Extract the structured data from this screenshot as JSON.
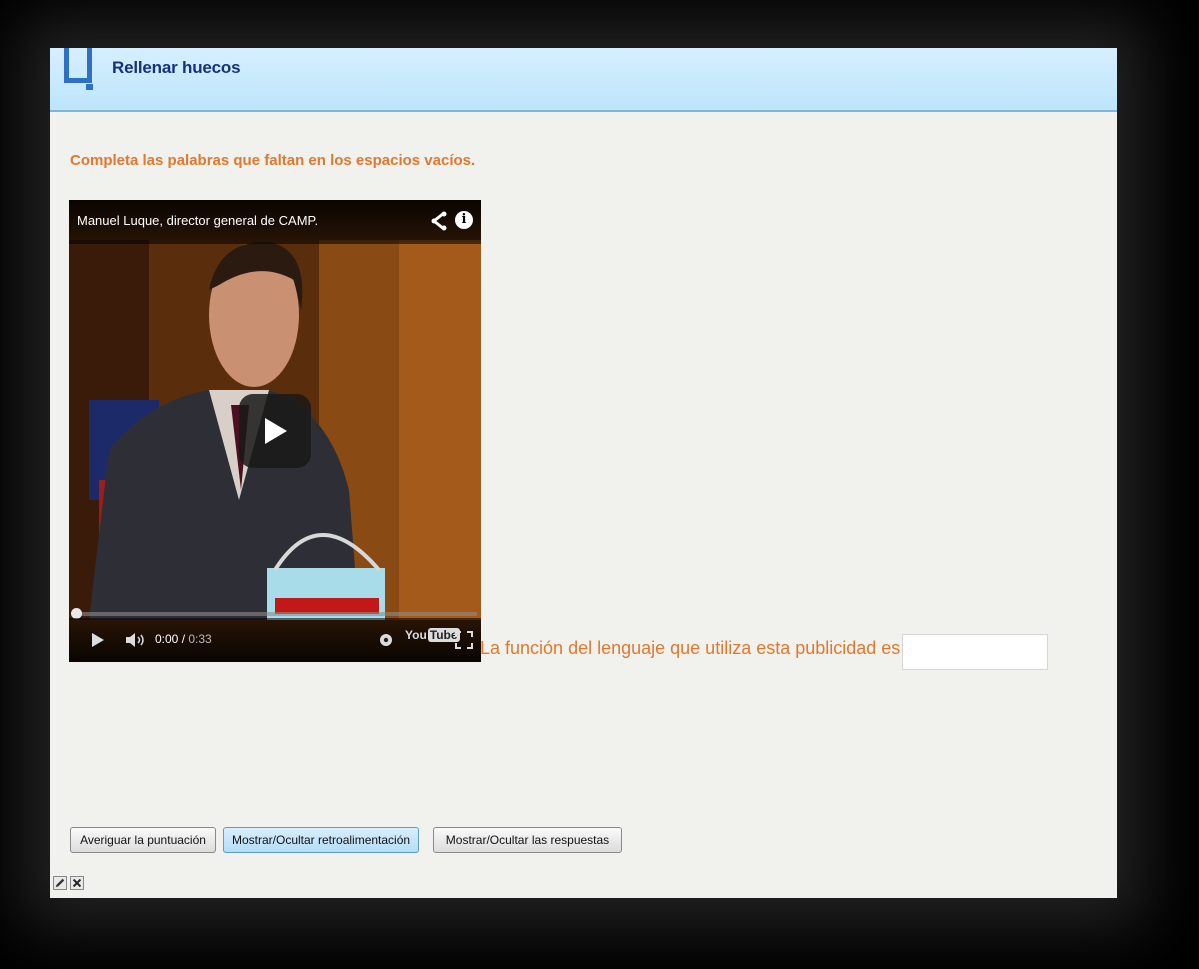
{
  "header": {
    "title": "Rellenar huecos",
    "icon": "fill-blanks-icon"
  },
  "instructions": "Completa las palabras que faltan en los espacios vacíos.",
  "video": {
    "title": "Manuel Luque, director general de CAMP.",
    "time_current": "0:00",
    "time_total": "0:33",
    "progress_fraction": 0,
    "logo_text": "You",
    "logo_box": "Tube",
    "icons": [
      "share-icon",
      "info-icon",
      "play-icon",
      "volume-icon",
      "settings-icon",
      "youtube-logo",
      "fullscreen-icon"
    ]
  },
  "question": {
    "text": "La función del lenguaje que utiliza esta publicidad es",
    "answer_value": ""
  },
  "buttons": {
    "score": "Averiguar la puntuación",
    "feedback": "Mostrar/Ocultar retroalimentación",
    "answers": "Mostrar/Ocultar las respuestas"
  },
  "tools": [
    "edit-icon",
    "delete-icon"
  ],
  "colors": {
    "header_bg": "#c6e9fc",
    "title": "#17317c",
    "accent_orange": "#e2782f",
    "page_bg": "#f1f1ed"
  }
}
